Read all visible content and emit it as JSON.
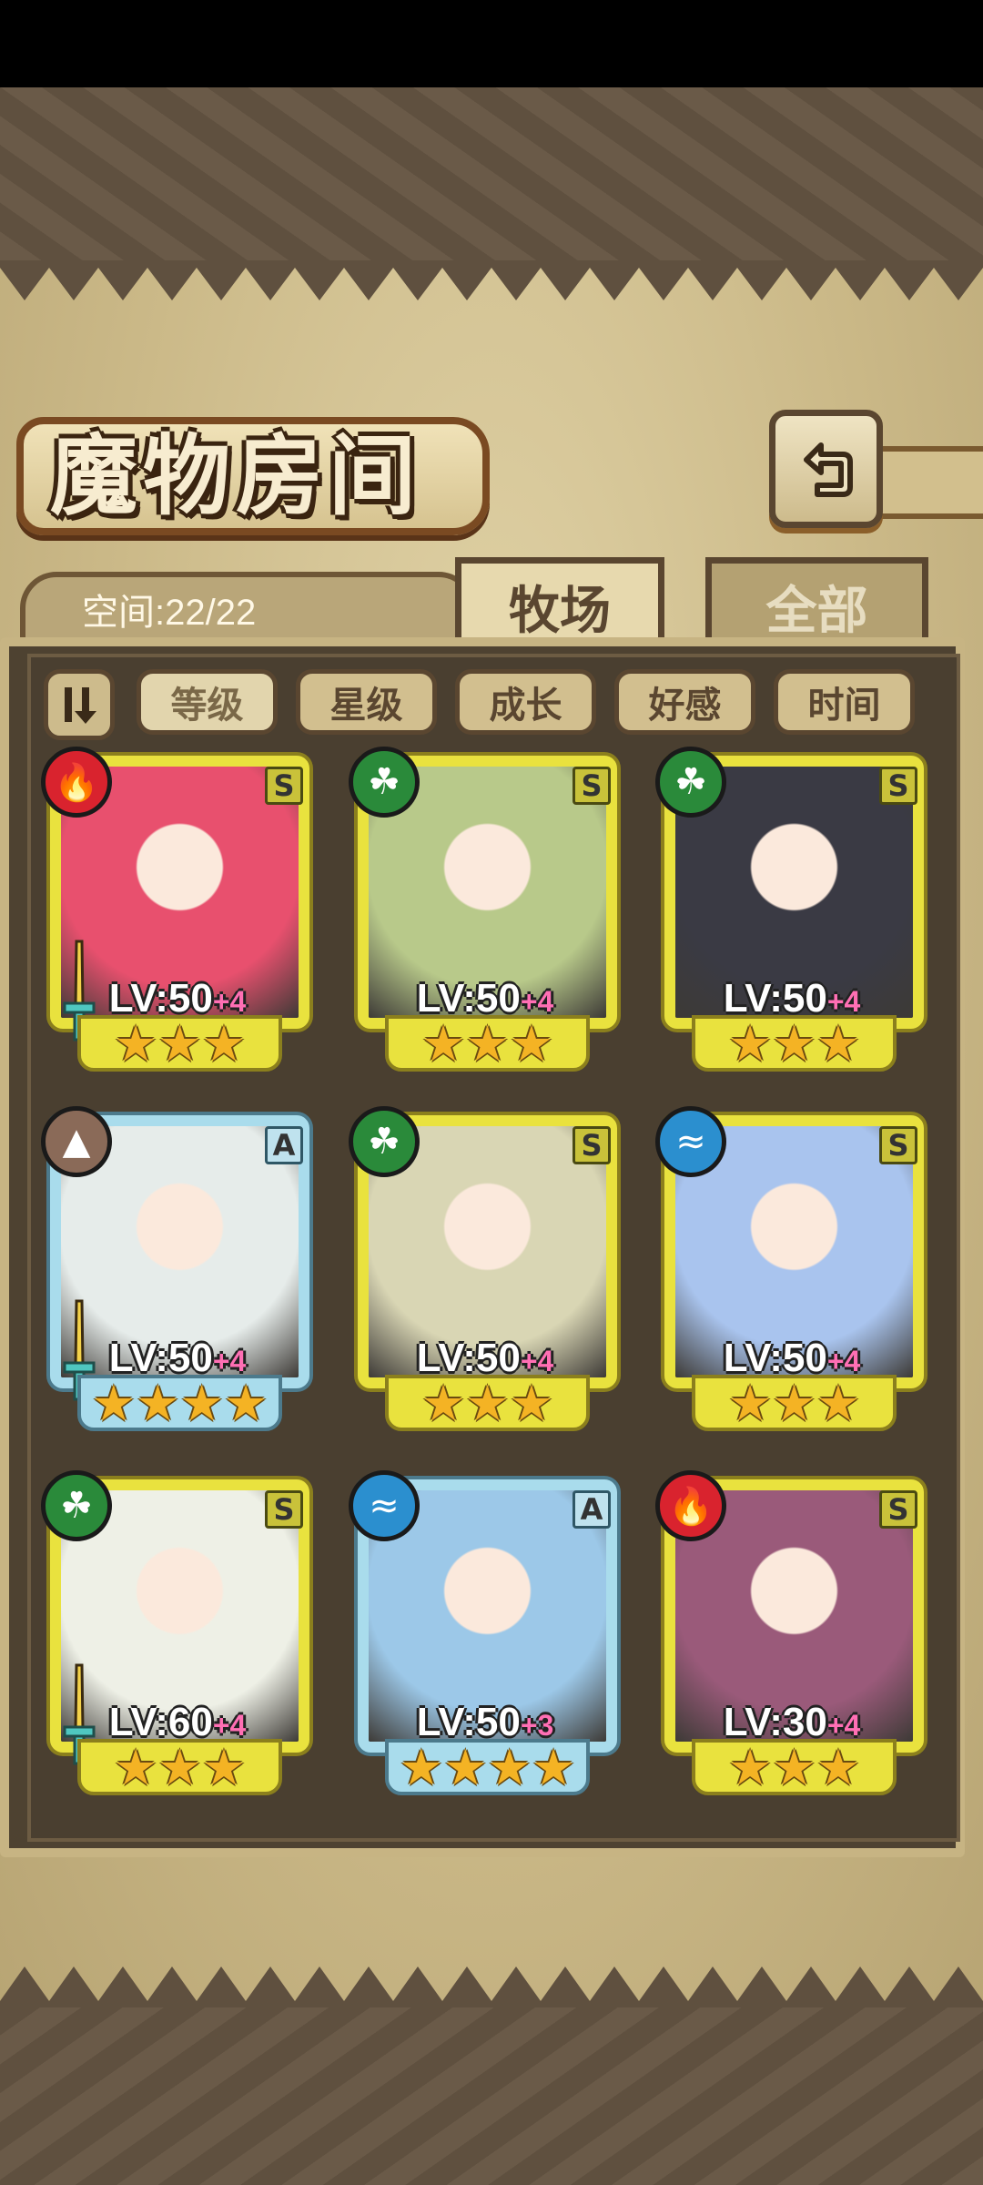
{
  "header": {
    "title": "魔物房间",
    "back_icon": "back-arrow-icon"
  },
  "capacity": {
    "text": "空间:22/22"
  },
  "tabs": [
    {
      "label": "牧场",
      "active": true
    },
    {
      "label": "全部",
      "active": false
    }
  ],
  "sort": {
    "toggle_icon": "sort-order-icon",
    "options": [
      {
        "label": "等级",
        "active": true
      },
      {
        "label": "星级",
        "active": false
      },
      {
        "label": "成长",
        "active": false
      },
      {
        "label": "好感",
        "active": false
      },
      {
        "label": "时间",
        "active": false
      }
    ]
  },
  "monsters": [
    {
      "level": "LV:50",
      "plus": "+4",
      "rank": "S",
      "element": "fire",
      "stars": "★★★",
      "portrait_color": "#e8506e",
      "equipped": true
    },
    {
      "level": "LV:50",
      "plus": "+4",
      "rank": "S",
      "element": "leaf",
      "stars": "★★★",
      "portrait_color": "#b8c98a",
      "equipped": false
    },
    {
      "level": "LV:50",
      "plus": "+4",
      "rank": "S",
      "element": "leaf",
      "stars": "★★★",
      "portrait_color": "#3a3a44",
      "equipped": false
    },
    {
      "level": "LV:50",
      "plus": "+4",
      "rank": "A",
      "element": "earth",
      "stars": "★★★★",
      "portrait_color": "#e6ecea",
      "equipped": true
    },
    {
      "level": "LV:50",
      "plus": "+4",
      "rank": "S",
      "element": "leaf",
      "stars": "★★★",
      "portrait_color": "#d9d6b4",
      "equipped": false
    },
    {
      "level": "LV:50",
      "plus": "+4",
      "rank": "S",
      "element": "water",
      "stars": "★★★",
      "portrait_color": "#a9c4ee",
      "equipped": false
    },
    {
      "level": "LV:60",
      "plus": "+4",
      "rank": "S",
      "element": "leaf",
      "stars": "★★★",
      "portrait_color": "#eef0e6",
      "equipped": true
    },
    {
      "level": "LV:50",
      "plus": "+3",
      "rank": "A",
      "element": "water",
      "stars": "★★★★",
      "portrait_color": "#9cc8e8",
      "equipped": false
    },
    {
      "level": "LV:30",
      "plus": "+4",
      "rank": "S",
      "element": "fire",
      "stars": "★★★",
      "portrait_color": "#9a5a7a",
      "equipped": false
    }
  ]
}
